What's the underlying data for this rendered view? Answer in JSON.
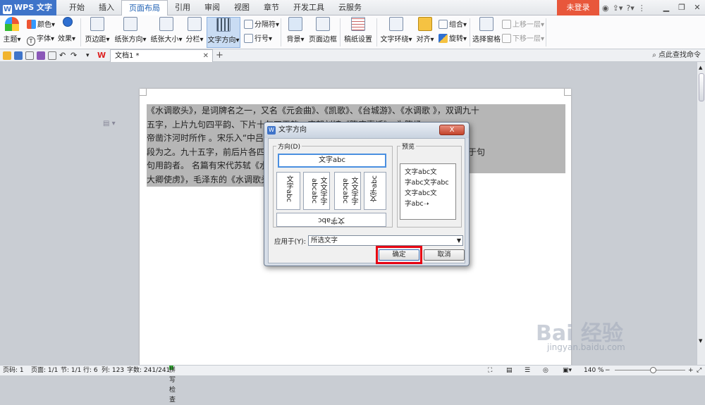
{
  "app": {
    "name": "WPS 文字",
    "logo": "W"
  },
  "tabs": [
    {
      "label": "开始"
    },
    {
      "label": "插入"
    },
    {
      "label": "页面布局"
    },
    {
      "label": "引用"
    },
    {
      "label": "审阅"
    },
    {
      "label": "视图"
    },
    {
      "label": "章节"
    },
    {
      "label": "开发工具"
    },
    {
      "label": "云服务"
    }
  ],
  "active_tab_index": 2,
  "login_label": "未登录",
  "ribbon": {
    "theme": "主题",
    "color": "颜色",
    "font": "字体",
    "effect": "效果",
    "margin": "页边距",
    "orientation": "纸张方向",
    "size": "纸张大小",
    "columns": "分栏",
    "text_direction": "文字方向",
    "separator": "分隔符",
    "line_number": "行号",
    "background": "背景",
    "border": "页面边框",
    "grid": "稿纸设置",
    "wrap": "文字环绕",
    "align": "对齐",
    "group": "组合",
    "rotate": "旋转",
    "selection_pane": "选择窗格",
    "bring_forward": "上移一层",
    "send_backward": "下移一层"
  },
  "doc_tab": {
    "title": "文档1 *"
  },
  "search_cmd": "点此查找命令",
  "document": {
    "lines": [
      "《水调歌头》，是词牌名之一，又名《元会曲》、《凯歌》、《台城游》、《水调歌 》，双调九十",
      "五字，上片九句四平韵、下片十句四平韵。唐朝刘𫗧《隋唐嘉话》，为隋炀",
      "帝凿汴河时所作 。宋乐入“中吕调”，凡大曲有“歌头”，此殆裁截其首",
      "段为之。九十五字，前后片各四平韵。亦有前后片两六言句夹叶仄韵者，有平仄互叶几于句",
      "句用韵者。 名篇有宋代苏轼《水调歌头·明月几时有》、宋代苏轼《水调歌头·送章德茂",
      "大卿使虏》，毛泽东的《水调歌头·游泳》等。"
    ]
  },
  "dialog": {
    "title": "文字方向",
    "close": "X",
    "direction_label": "方向(D)",
    "preview_label": "预览",
    "opt_horizontal": "文字abc",
    "opt_v1": "文字abc",
    "opt_v2": "文文字字abcabc",
    "opt_v3": "文文字字abcabc",
    "opt_v4": "文字abc",
    "opt_flip": "文字abc",
    "preview_lines": [
      "文字abc文",
      "字abc文字abc",
      "文字abc文",
      "字abc"
    ],
    "apply_label": "应用于(Y):",
    "apply_value": "所选文字",
    "ok": "确定",
    "cancel": "取消"
  },
  "status": {
    "page_no": "页码: 1",
    "pages": "页面: 1/1",
    "section": "节: 1/1",
    "row": "行: 6",
    "col": "列: 123",
    "word_count": "字数: 241/241",
    "spell": "拼写检查",
    "zoom": "140 %"
  },
  "watermark": {
    "text": "Bai 经验",
    "sub": "jingyan.baidu.com"
  }
}
